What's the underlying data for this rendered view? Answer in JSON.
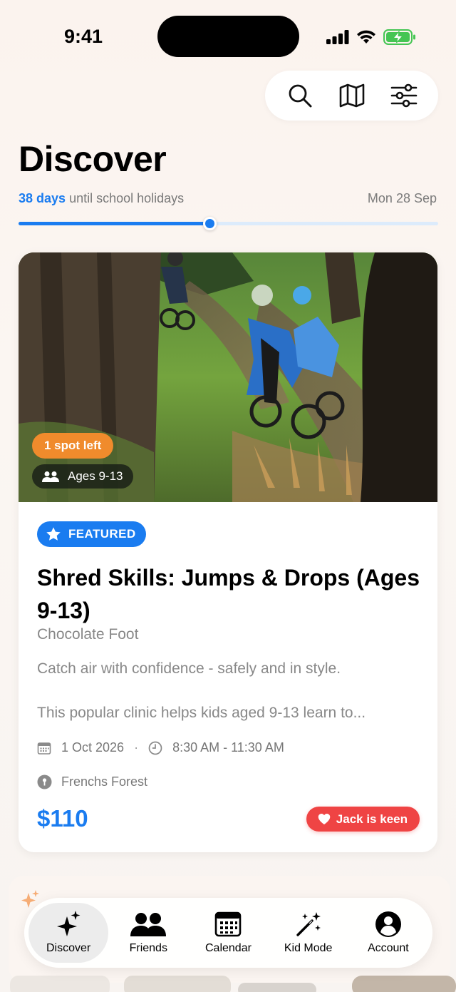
{
  "status_bar": {
    "time": "9:41"
  },
  "toolbar": {
    "search_icon": "search-icon",
    "map_icon": "map-icon",
    "filter_icon": "sliders-icon"
  },
  "header": {
    "title": "Discover",
    "countdown_days": "38 days",
    "countdown_text": " until school holidays",
    "holiday_date": "Mon 28 Sep",
    "progress": 0.455
  },
  "card": {
    "spots_left": "1 spot left",
    "ages": "Ages 9-13",
    "featured_label": "FEATURED",
    "title": "Shred Skills: Jumps & Drops (Ages 9-13)",
    "location": "Chocolate Foot",
    "tagline": "Catch air with confidence - safely and in style.",
    "description": "This popular clinic helps kids aged 9-13 learn to...",
    "date": "1 Oct 2026",
    "separator": "·",
    "time": "8:30 AM - 11:30 AM",
    "venue": "Frenchs Forest",
    "price": "$110",
    "keen_label": "Jack is keen"
  },
  "tabs": [
    {
      "label": "Discover",
      "icon": "sparkles-icon",
      "active": true
    },
    {
      "label": "Friends",
      "icon": "people-icon",
      "active": false
    },
    {
      "label": "Calendar",
      "icon": "calendar-icon",
      "active": false
    },
    {
      "label": "Kid Mode",
      "icon": "magic-wand-icon",
      "active": false
    },
    {
      "label": "Account",
      "icon": "account-icon",
      "active": false
    }
  ],
  "colors": {
    "accent": "#1a7cf0",
    "orange": "#f08b2c",
    "keen_red": "#ef4444"
  }
}
